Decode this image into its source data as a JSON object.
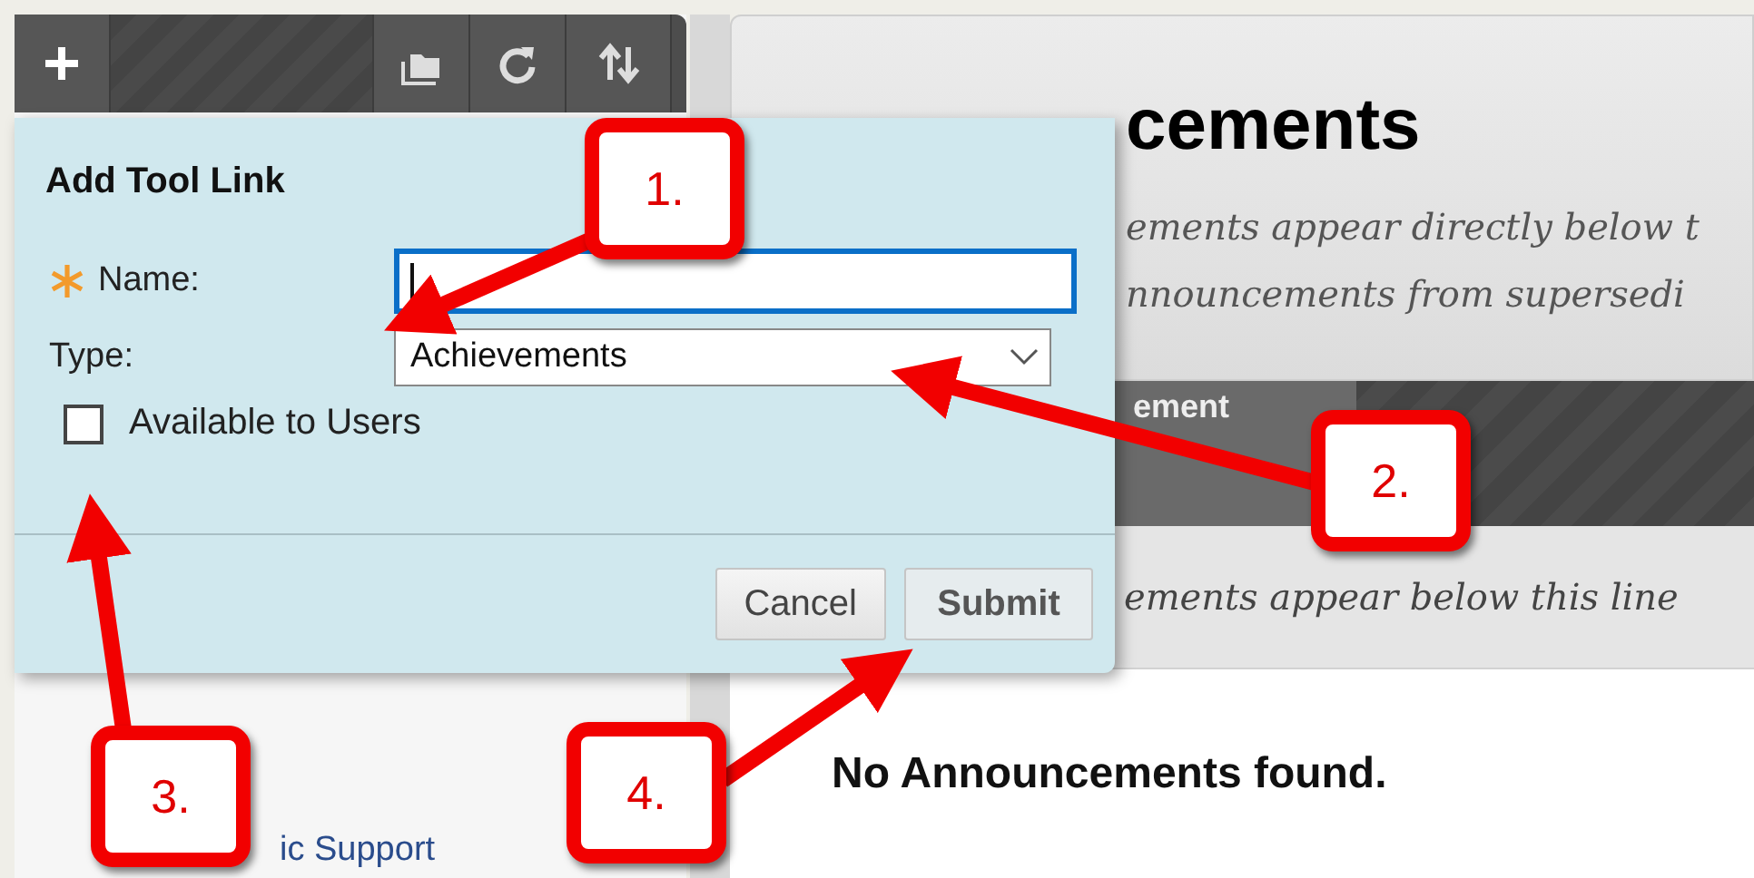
{
  "sidebar": {
    "links": [
      "ic Support"
    ]
  },
  "content": {
    "heading": "cements",
    "description": [
      "ements appear directly below t",
      "nnouncements from supersedi"
    ],
    "toolbar_button": "ement",
    "divider_note": "ements appear below this line",
    "empty_message": "No Announcements found."
  },
  "dialog": {
    "title": "Add Tool Link",
    "fields": [
      {
        "kind": "text",
        "label": "Name:",
        "required": true,
        "focused": true
      },
      {
        "kind": "select",
        "label": "Type:",
        "required": false,
        "focused": false,
        "value": "Achievements"
      }
    ],
    "checkbox": {
      "label": "Available to Users",
      "checked": false
    },
    "buttons": [
      {
        "label": "Cancel",
        "primary": false
      },
      {
        "label": "Submit",
        "primary": true
      }
    ]
  },
  "callouts": [
    {
      "label": "1."
    },
    {
      "label": "2."
    },
    {
      "label": "3."
    },
    {
      "label": "4."
    }
  ]
}
